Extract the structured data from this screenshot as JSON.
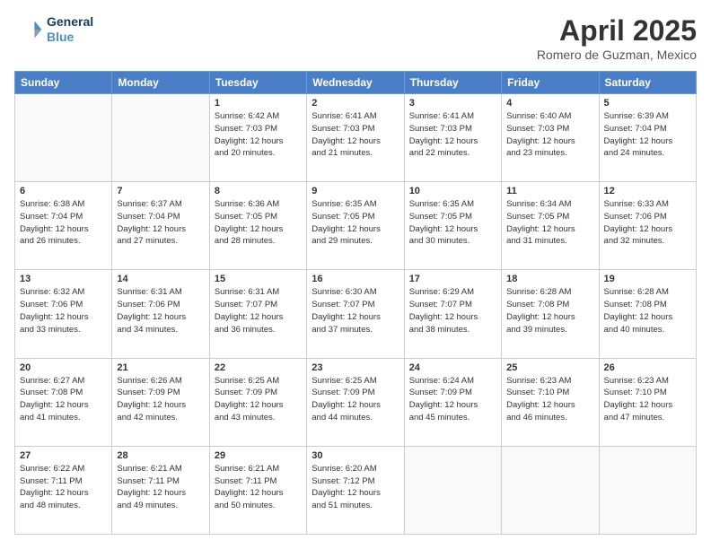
{
  "header": {
    "logo_line1": "General",
    "logo_line2": "Blue",
    "title": "April 2025",
    "location": "Romero de Guzman, Mexico"
  },
  "columns": [
    "Sunday",
    "Monday",
    "Tuesday",
    "Wednesday",
    "Thursday",
    "Friday",
    "Saturday"
  ],
  "weeks": [
    [
      {
        "day": "",
        "info": ""
      },
      {
        "day": "",
        "info": ""
      },
      {
        "day": "1",
        "info": "Sunrise: 6:42 AM\nSunset: 7:03 PM\nDaylight: 12 hours\nand 20 minutes."
      },
      {
        "day": "2",
        "info": "Sunrise: 6:41 AM\nSunset: 7:03 PM\nDaylight: 12 hours\nand 21 minutes."
      },
      {
        "day": "3",
        "info": "Sunrise: 6:41 AM\nSunset: 7:03 PM\nDaylight: 12 hours\nand 22 minutes."
      },
      {
        "day": "4",
        "info": "Sunrise: 6:40 AM\nSunset: 7:03 PM\nDaylight: 12 hours\nand 23 minutes."
      },
      {
        "day": "5",
        "info": "Sunrise: 6:39 AM\nSunset: 7:04 PM\nDaylight: 12 hours\nand 24 minutes."
      }
    ],
    [
      {
        "day": "6",
        "info": "Sunrise: 6:38 AM\nSunset: 7:04 PM\nDaylight: 12 hours\nand 26 minutes."
      },
      {
        "day": "7",
        "info": "Sunrise: 6:37 AM\nSunset: 7:04 PM\nDaylight: 12 hours\nand 27 minutes."
      },
      {
        "day": "8",
        "info": "Sunrise: 6:36 AM\nSunset: 7:05 PM\nDaylight: 12 hours\nand 28 minutes."
      },
      {
        "day": "9",
        "info": "Sunrise: 6:35 AM\nSunset: 7:05 PM\nDaylight: 12 hours\nand 29 minutes."
      },
      {
        "day": "10",
        "info": "Sunrise: 6:35 AM\nSunset: 7:05 PM\nDaylight: 12 hours\nand 30 minutes."
      },
      {
        "day": "11",
        "info": "Sunrise: 6:34 AM\nSunset: 7:05 PM\nDaylight: 12 hours\nand 31 minutes."
      },
      {
        "day": "12",
        "info": "Sunrise: 6:33 AM\nSunset: 7:06 PM\nDaylight: 12 hours\nand 32 minutes."
      }
    ],
    [
      {
        "day": "13",
        "info": "Sunrise: 6:32 AM\nSunset: 7:06 PM\nDaylight: 12 hours\nand 33 minutes."
      },
      {
        "day": "14",
        "info": "Sunrise: 6:31 AM\nSunset: 7:06 PM\nDaylight: 12 hours\nand 34 minutes."
      },
      {
        "day": "15",
        "info": "Sunrise: 6:31 AM\nSunset: 7:07 PM\nDaylight: 12 hours\nand 36 minutes."
      },
      {
        "day": "16",
        "info": "Sunrise: 6:30 AM\nSunset: 7:07 PM\nDaylight: 12 hours\nand 37 minutes."
      },
      {
        "day": "17",
        "info": "Sunrise: 6:29 AM\nSunset: 7:07 PM\nDaylight: 12 hours\nand 38 minutes."
      },
      {
        "day": "18",
        "info": "Sunrise: 6:28 AM\nSunset: 7:08 PM\nDaylight: 12 hours\nand 39 minutes."
      },
      {
        "day": "19",
        "info": "Sunrise: 6:28 AM\nSunset: 7:08 PM\nDaylight: 12 hours\nand 40 minutes."
      }
    ],
    [
      {
        "day": "20",
        "info": "Sunrise: 6:27 AM\nSunset: 7:08 PM\nDaylight: 12 hours\nand 41 minutes."
      },
      {
        "day": "21",
        "info": "Sunrise: 6:26 AM\nSunset: 7:09 PM\nDaylight: 12 hours\nand 42 minutes."
      },
      {
        "day": "22",
        "info": "Sunrise: 6:25 AM\nSunset: 7:09 PM\nDaylight: 12 hours\nand 43 minutes."
      },
      {
        "day": "23",
        "info": "Sunrise: 6:25 AM\nSunset: 7:09 PM\nDaylight: 12 hours\nand 44 minutes."
      },
      {
        "day": "24",
        "info": "Sunrise: 6:24 AM\nSunset: 7:09 PM\nDaylight: 12 hours\nand 45 minutes."
      },
      {
        "day": "25",
        "info": "Sunrise: 6:23 AM\nSunset: 7:10 PM\nDaylight: 12 hours\nand 46 minutes."
      },
      {
        "day": "26",
        "info": "Sunrise: 6:23 AM\nSunset: 7:10 PM\nDaylight: 12 hours\nand 47 minutes."
      }
    ],
    [
      {
        "day": "27",
        "info": "Sunrise: 6:22 AM\nSunset: 7:11 PM\nDaylight: 12 hours\nand 48 minutes."
      },
      {
        "day": "28",
        "info": "Sunrise: 6:21 AM\nSunset: 7:11 PM\nDaylight: 12 hours\nand 49 minutes."
      },
      {
        "day": "29",
        "info": "Sunrise: 6:21 AM\nSunset: 7:11 PM\nDaylight: 12 hours\nand 50 minutes."
      },
      {
        "day": "30",
        "info": "Sunrise: 6:20 AM\nSunset: 7:12 PM\nDaylight: 12 hours\nand 51 minutes."
      },
      {
        "day": "",
        "info": ""
      },
      {
        "day": "",
        "info": ""
      },
      {
        "day": "",
        "info": ""
      }
    ]
  ]
}
